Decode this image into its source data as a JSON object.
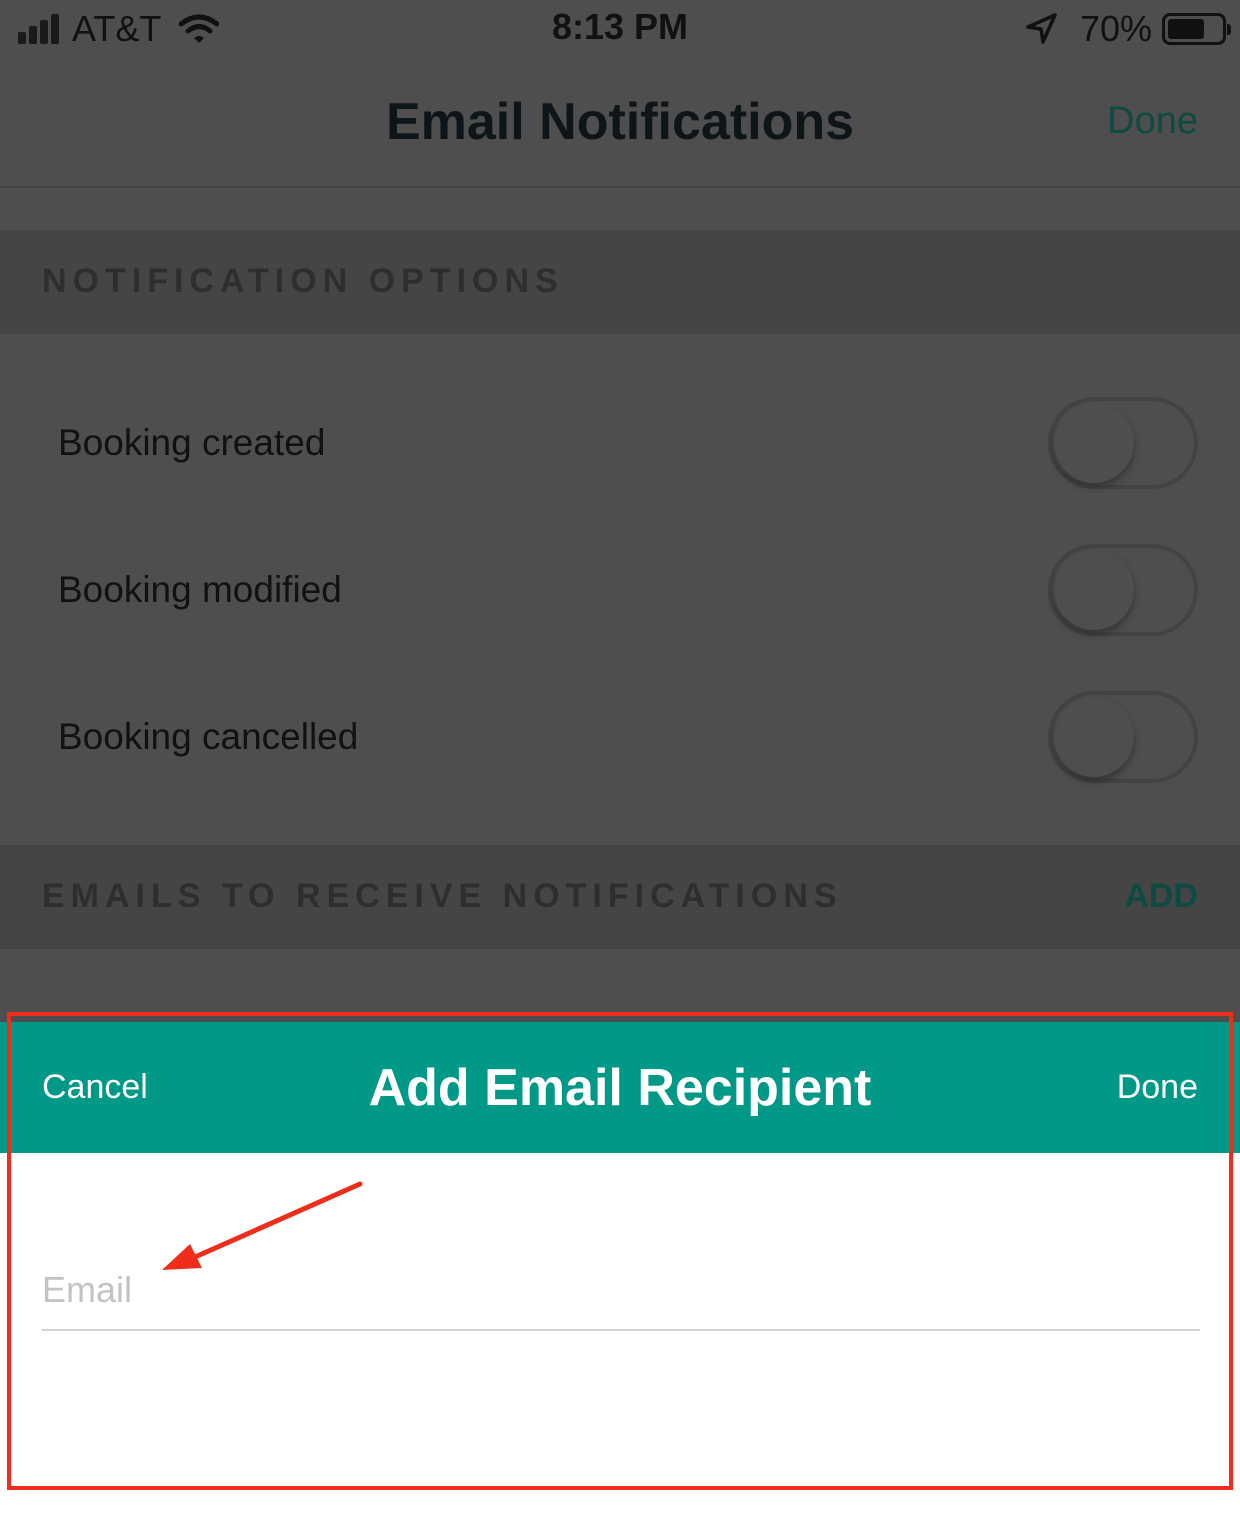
{
  "status_bar": {
    "carrier": "AT&T",
    "time": "8:13 PM",
    "battery_percent": "70%",
    "battery_level": 0.7,
    "icons": [
      "signal-bars-icon",
      "wifi-icon",
      "location-arrow-icon",
      "battery-icon"
    ]
  },
  "nav": {
    "title": "Email Notifications",
    "done_label": "Done"
  },
  "notification_options": {
    "header": "NOTIFICATION OPTIONS",
    "items": [
      {
        "label": "Booking created",
        "enabled": false
      },
      {
        "label": "Booking modified",
        "enabled": false
      },
      {
        "label": "Booking cancelled",
        "enabled": false
      }
    ]
  },
  "emails_section": {
    "header": "EMAILS TO RECEIVE NOTIFICATIONS",
    "add_label": "ADD"
  },
  "modal": {
    "cancel_label": "Cancel",
    "title": "Add Email Recipient",
    "done_label": "Done",
    "email_placeholder": "Email",
    "email_value": ""
  },
  "colors": {
    "accent": "#009886",
    "annotation": "#ee2e1a",
    "scrim_background": "#4e4e4e"
  }
}
